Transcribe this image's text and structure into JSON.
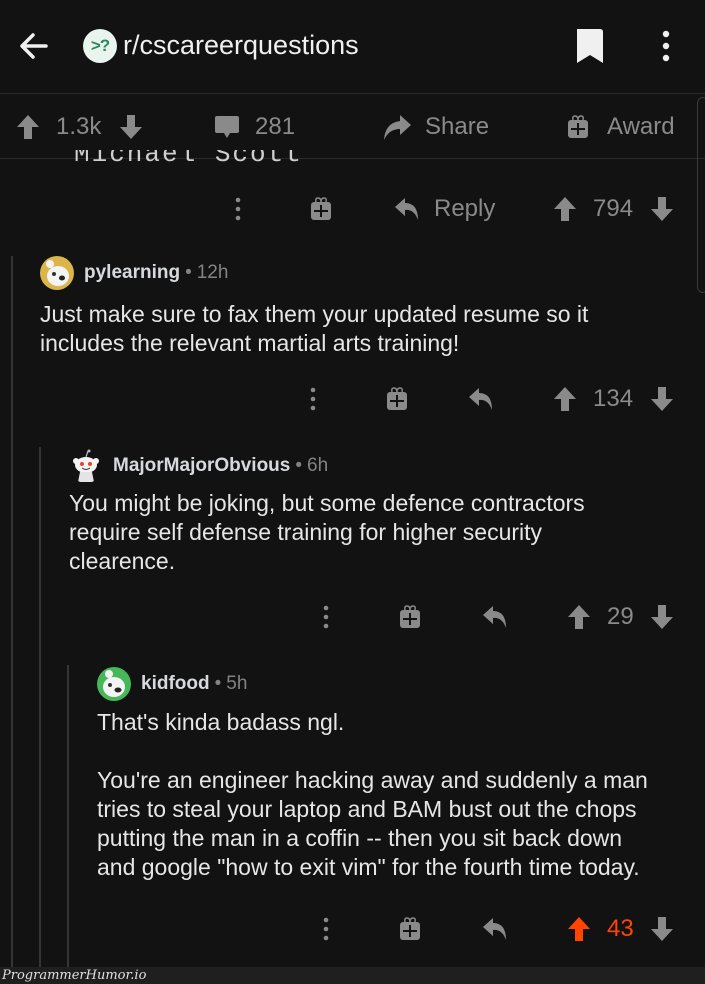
{
  "header": {
    "subreddit": "r/cscareerquestions",
    "subreddit_icon_text": ">?"
  },
  "post_actions": {
    "score": "1.3k",
    "comments": "281",
    "share_label": "Share",
    "award_label": "Award"
  },
  "parent_comment_cut_text": "Michael Scott",
  "parent_comment_actions": {
    "reply_label": "Reply",
    "score": "794"
  },
  "comments": [
    {
      "username": "pylearning",
      "time": "12h",
      "body": "Just make sure to fax them your updated resume so it\nincludes the relevant martial arts training!",
      "score": "134",
      "upvoted": false,
      "avatar_color": "#d9b54a"
    },
    {
      "username": "MajorMajorObvious",
      "time": "6h",
      "body": "You might be joking, but some defence contractors\nrequire self defense training for higher security\nclearence.",
      "score": "29",
      "upvoted": false,
      "avatar_color": "#121212"
    },
    {
      "username": "kidfood",
      "time": "5h",
      "body": "That's kinda badass ngl.\n\nYou're an engineer hacking away and suddenly a man\ntries to steal your laptop and BAM bust out the chops\nputting the man in a coffin -- then you sit back down\nand google \"how to exit vim\" for the fourth time today.",
      "score": "43",
      "upvoted": true,
      "avatar_color": "#46b85a"
    }
  ],
  "colors": {
    "background": "#121212",
    "upvote_active": "#ff4500",
    "icon_gray": "#8a8a8a"
  },
  "watermark": "ProgrammerHumor.io"
}
